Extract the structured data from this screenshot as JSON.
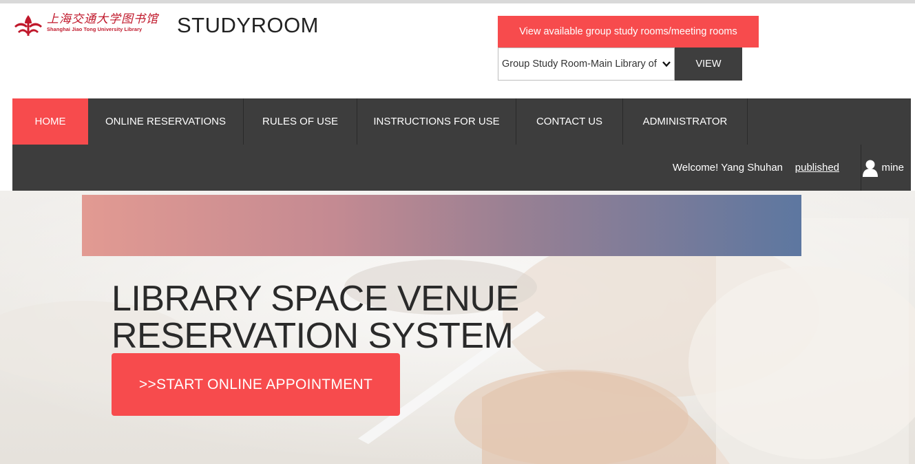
{
  "logo": {
    "chinese_name": "上海交通大学图书馆",
    "english_name": "Shanghai Jiao Tong University Library"
  },
  "app_title": "STUDYROOM",
  "view_available": {
    "label": "View available group study rooms/meeting rooms"
  },
  "room_select": {
    "selected": "Group Study Room-Main Library of"
  },
  "view_button": "VIEW",
  "nav": {
    "items": [
      {
        "label": "HOME"
      },
      {
        "label": "ONLINE RESERVATIONS"
      },
      {
        "label": "RULES OF USE"
      },
      {
        "label": "INSTRUCTIONS FOR USE"
      },
      {
        "label": "CONTACT US"
      },
      {
        "label": "ADMINISTRATOR"
      }
    ],
    "active_index": 0
  },
  "user_bar": {
    "welcome": "Welcome! Yang Shuhan",
    "published": "published",
    "mine": "mine"
  },
  "hero": {
    "title_line1": "LIBRARY SPACE VENUE",
    "title_line2": "RESERVATION SYSTEM",
    "start_button": ">>START ONLINE APPOINTMENT"
  },
  "colors": {
    "accent": "#f74b4d",
    "nav_bg": "#3d3d3d",
    "logo_red": "#c0182b"
  },
  "icons": [
    "logo-mark-icon",
    "chevron-down-icon",
    "user-icon"
  ]
}
